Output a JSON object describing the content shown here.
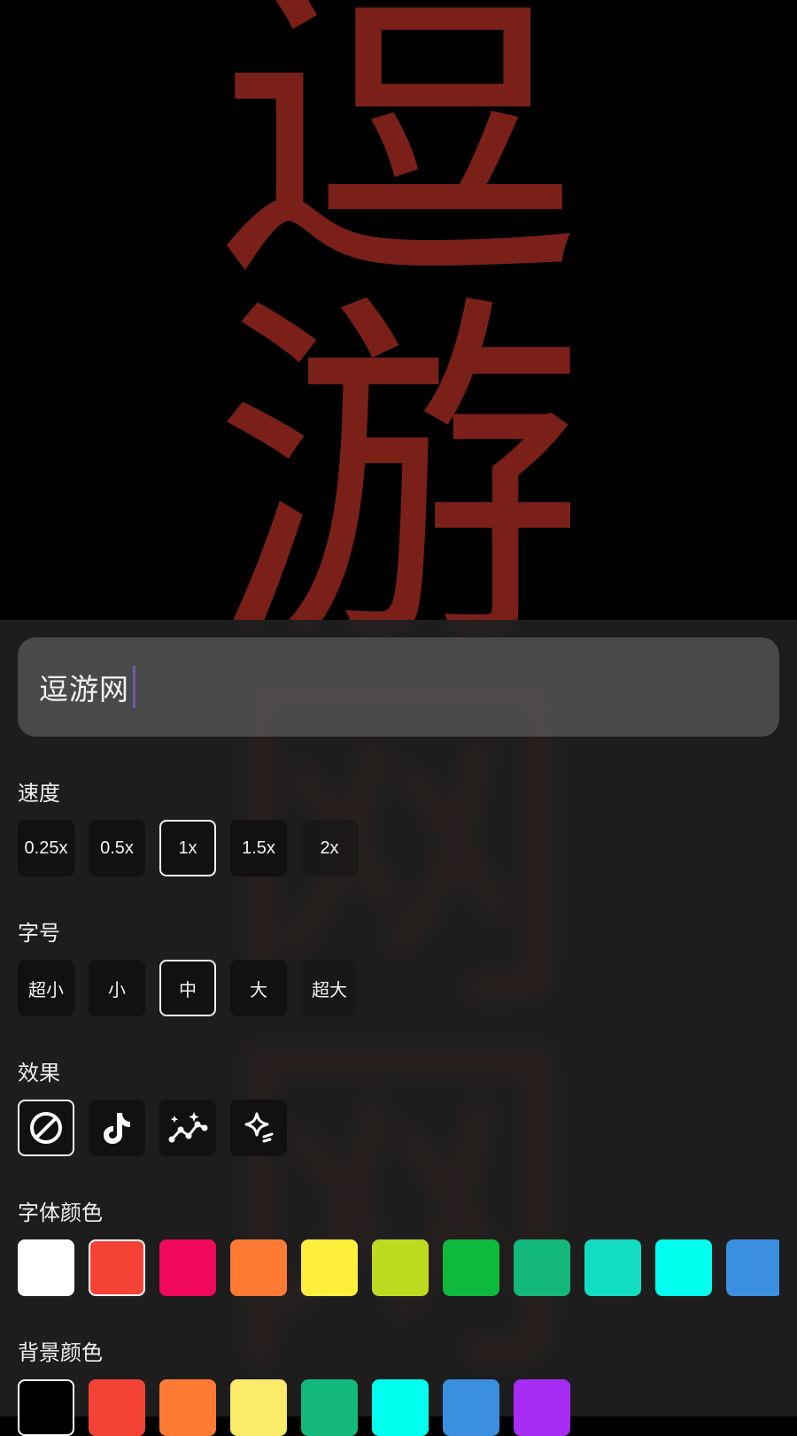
{
  "preview": {
    "marquee_chars": [
      "逗",
      "游",
      "网",
      "网"
    ],
    "text_color": "#7a2019",
    "background_color": "#000000"
  },
  "input": {
    "value": "逗游网"
  },
  "speed": {
    "label": "速度",
    "options": [
      "0.25x",
      "0.5x",
      "1x",
      "1.5x",
      "2x"
    ],
    "selected": "1x"
  },
  "font_size": {
    "label": "字号",
    "options": [
      "超小",
      "小",
      "中",
      "大",
      "超大"
    ],
    "selected": "中"
  },
  "effect": {
    "label": "效果",
    "options": [
      "none-icon",
      "tiktok-icon",
      "sparkle-chart-icon",
      "ai-star-icon"
    ],
    "selected": "none-icon"
  },
  "font_color": {
    "label": "字体颜色",
    "colors": [
      "#ffffff",
      "#f44336",
      "#f0085a",
      "#ff7b33",
      "#ffee3a",
      "#bddc21",
      "#0eba3c",
      "#14b87d",
      "#12dcc1",
      "#00ffee",
      "#3a8fdf"
    ],
    "selected": "#f44336"
  },
  "background_color": {
    "label": "背景颜色",
    "colors": [
      "#000000",
      "#f44336",
      "#ff7b33",
      "#fbeb68",
      "#14b87d",
      "#00ffee",
      "#3a8fdf",
      "#a72cf4"
    ],
    "selected": "#000000"
  }
}
